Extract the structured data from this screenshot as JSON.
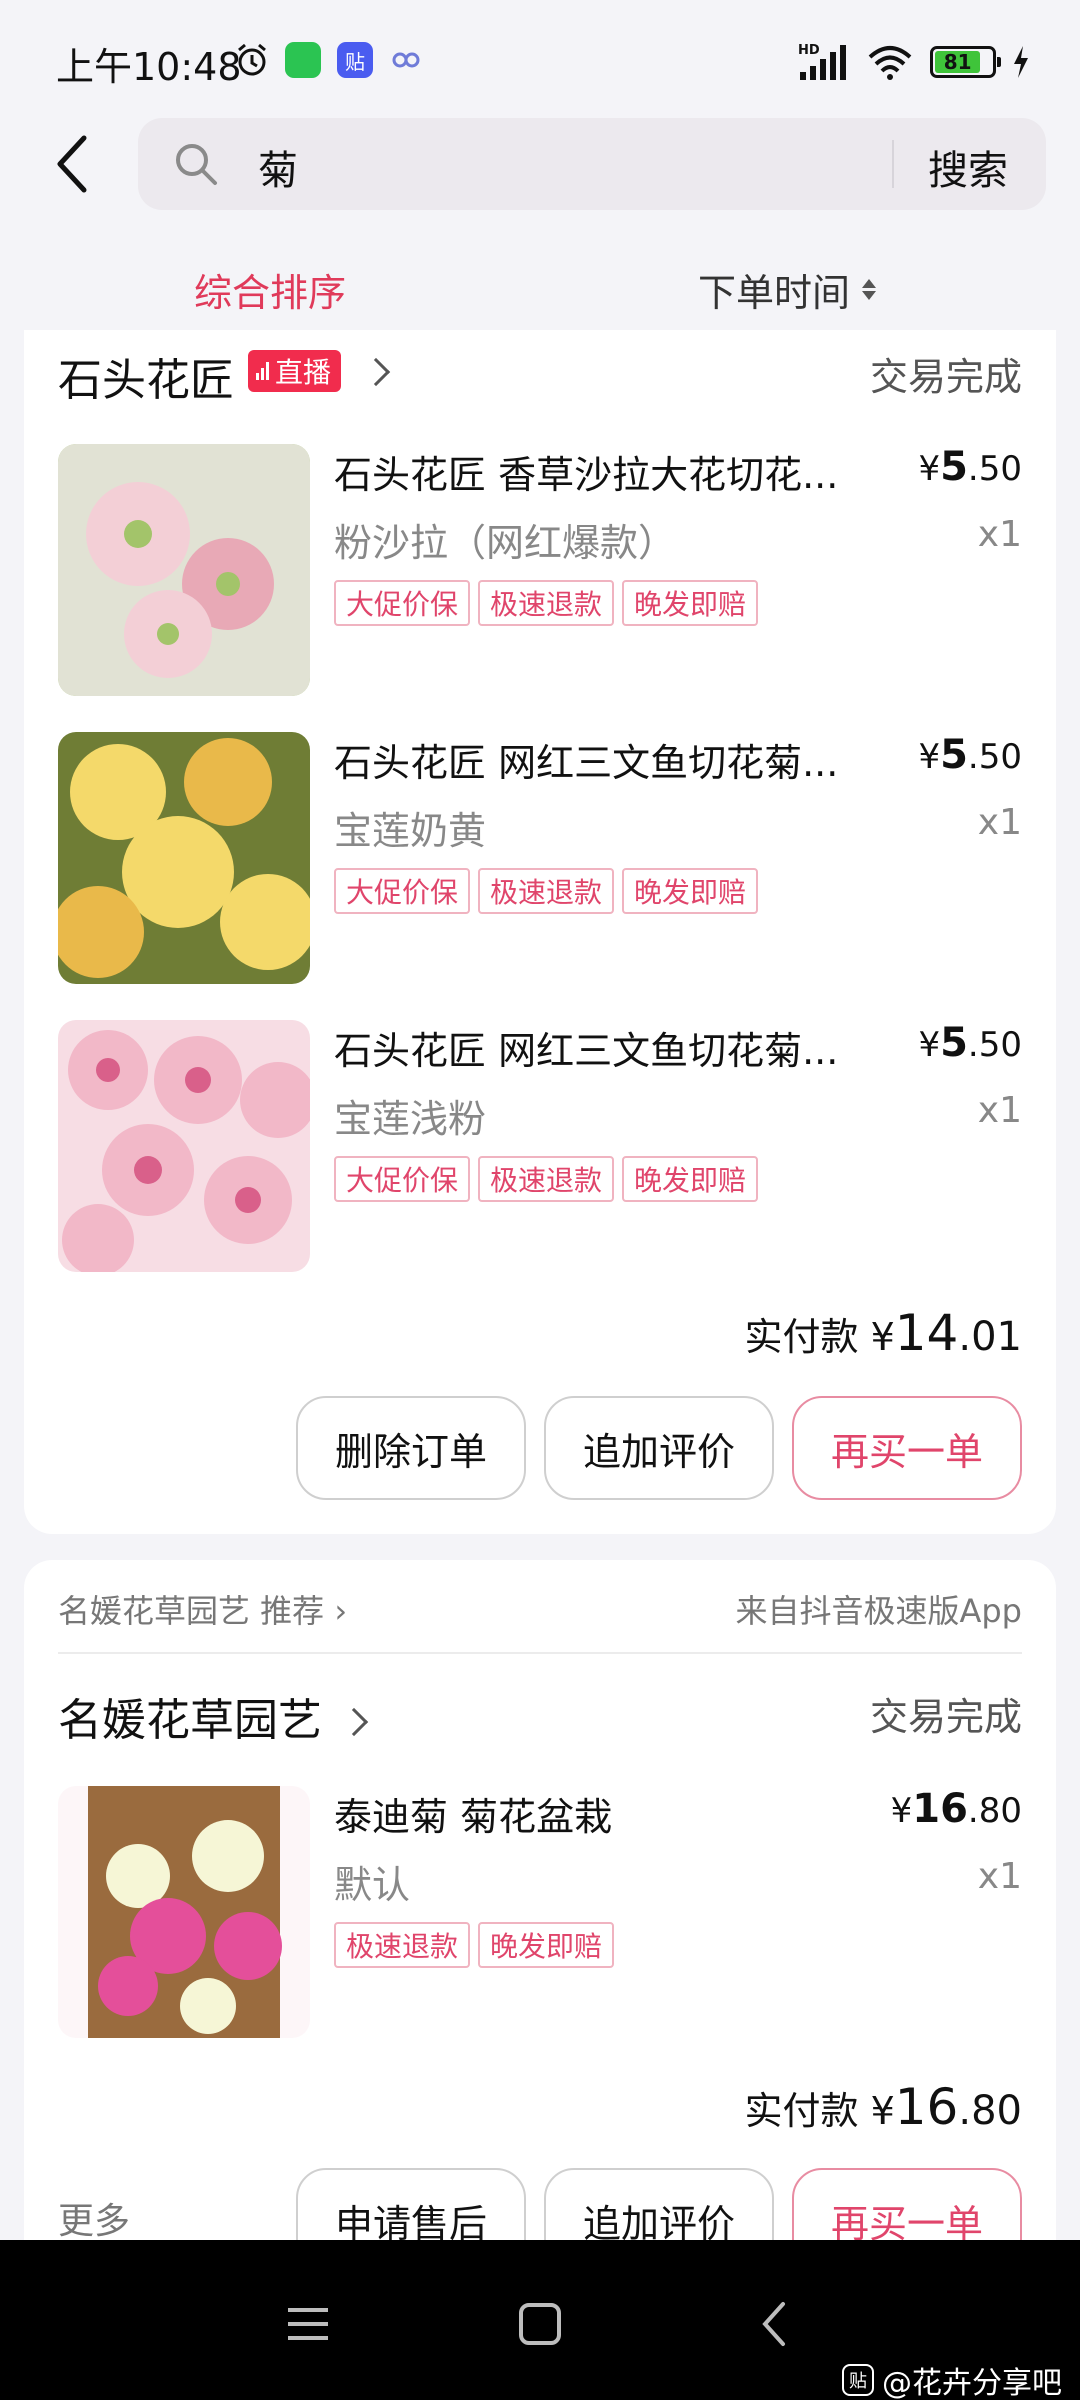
{
  "status_bar": {
    "time": "上午10:48",
    "battery_level": "81",
    "battery_fraction": 0.81,
    "network": "HD",
    "icons": [
      "alarm-icon",
      "wechat-icon",
      "tieba-icon",
      "butterfly-app-icon",
      "signal-icon",
      "wifi-icon",
      "charging-icon"
    ]
  },
  "header": {
    "back_icon": "back-arrow-icon",
    "search_query": "菊",
    "search_button": "搜索"
  },
  "sort_tabs": {
    "comprehensive": "综合排序",
    "order_time": "下单时间"
  },
  "orders": [
    {
      "shop_name": "石头花匠",
      "live_badge": "直播",
      "status": "交易完成",
      "items": [
        {
          "title": "石头花匠 香草沙拉大花切花...",
          "price_currency": "¥",
          "price_int": "5",
          "price_dec": ".50",
          "spec": "粉沙拉（网红爆款）",
          "qty": "x1",
          "tags": [
            "大促价保",
            "极速退款",
            "晚发即赔"
          ],
          "image_colors": [
            "#f3cfd6",
            "#e8a9b6",
            "#a3c46a"
          ]
        },
        {
          "title": "石头花匠 网红三文鱼切花菊...",
          "price_currency": "¥",
          "price_int": "5",
          "price_dec": ".50",
          "spec": "宝莲奶黄",
          "qty": "x1",
          "tags": [
            "大促价保",
            "极速退款",
            "晚发即赔"
          ],
          "image_colors": [
            "#f4d96a",
            "#e9b94a",
            "#6f7d35"
          ]
        },
        {
          "title": "石头花匠 网红三文鱼切花菊...",
          "price_currency": "¥",
          "price_int": "5",
          "price_dec": ".50",
          "spec": "宝莲浅粉",
          "qty": "x1",
          "tags": [
            "大促价保",
            "极速退款",
            "晚发即赔"
          ],
          "image_colors": [
            "#f2b8c8",
            "#d9608a",
            "#f7dde4"
          ]
        }
      ],
      "total_label": "实付款",
      "total_currency": "¥",
      "total_int": "14",
      "total_dec": ".01",
      "actions": [
        "删除订单",
        "追加评价",
        "再买一单"
      ]
    },
    {
      "recommend_text": "名媛花草园艺 推荐",
      "source_text": "来自抖音极速版App",
      "shop_name": "名媛花草园艺",
      "status": "交易完成",
      "items": [
        {
          "title": "泰迪菊 菊花盆栽",
          "price_currency": "¥",
          "price_int": "16",
          "price_dec": ".80",
          "spec": "默认",
          "qty": "x1",
          "tags": [
            "极速退款",
            "晚发即赔"
          ],
          "image_colors": [
            "#e44f9a",
            "#f6f6d6",
            "#9a6b3e"
          ]
        }
      ],
      "total_label": "实付款",
      "total_currency": "¥",
      "total_int": "16",
      "total_dec": ".80",
      "more_label": "更多",
      "actions": [
        "申请售后",
        "追加评价",
        "再买一单"
      ]
    }
  ],
  "nav_bar": {
    "icons": [
      "menu-icon",
      "home-icon",
      "back-icon"
    ],
    "watermark_text": "@花卉分享吧",
    "watermark_badge": "贴"
  },
  "colors": {
    "accent": "#e03a5a",
    "live_badge": "#f12c4d",
    "tag_text": "#e0456b",
    "background": "#f4f4f8"
  }
}
